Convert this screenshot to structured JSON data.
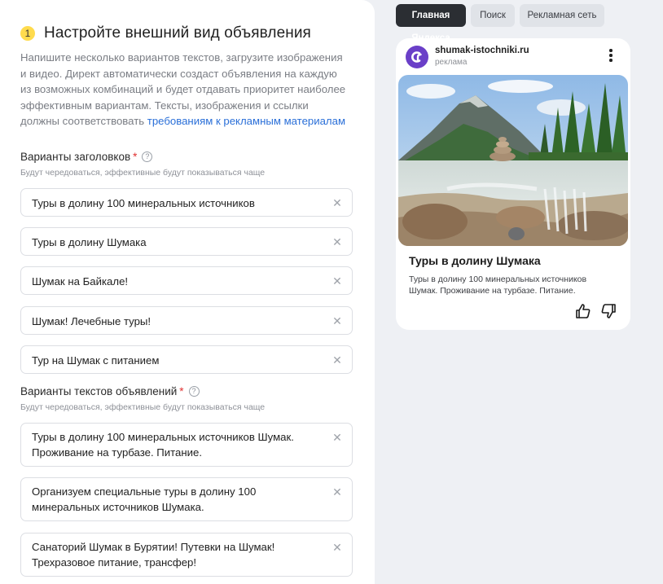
{
  "step": {
    "number": "1",
    "title": "Настройте внешний вид объявления",
    "description_prefix": "Напишите несколько вариантов текстов, загрузите изображения и видео. Директ автоматически создаст объявления на каждую из возможных комбинаций и будет отдавать приоритет наиболее эффективным вариантам. Тексты, изображения и ссылки должны соответствовать ",
    "description_link": "требованиям к рекламным материалам"
  },
  "headlines": {
    "label": "Варианты заголовков",
    "required_mark": "*",
    "help_icon": "?",
    "hint": "Будут чередоваться, эффективные будут показываться чаще",
    "items": [
      "Туры в долину 100 минеральных источников",
      "Туры в долину Шумака",
      "Шумак на Байкале!",
      "Шумак! Лечебные туры!",
      "Тур на Шумак с питанием"
    ]
  },
  "texts": {
    "label": "Варианты текстов объявлений",
    "required_mark": "*",
    "help_icon": "?",
    "hint": "Будут чередоваться, эффективные будут показываться чаще",
    "items": [
      "Туры в долину 100 минеральных источников Шумак. Проживание на турбазе. Питание.",
      "Организуем специальные туры в долину 100 минеральных источников Шумака.",
      "Санаторий Шумак в Бурятии! Путевки на Шумак! Трехразовое питание, трансфер!"
    ]
  },
  "clear_icon": "✕",
  "preview": {
    "tabs": [
      "Главная Яндекса",
      "Поиск",
      "Рекламная сеть"
    ],
    "active_tab": 0,
    "ad": {
      "domain": "shumak-istochniki.ru",
      "label": "реклама",
      "title": "Туры в долину Шумака",
      "text": "Туры в долину 100 минеральных источников Шумак. Проживание на турбазе. Питание."
    }
  },
  "colors": {
    "accent_link": "#2a6fd8",
    "step_badge": "#ffdb4d",
    "required": "#e03030",
    "active_tab_bg": "#2b2e33",
    "logo_bg": "#6a3fc8"
  }
}
